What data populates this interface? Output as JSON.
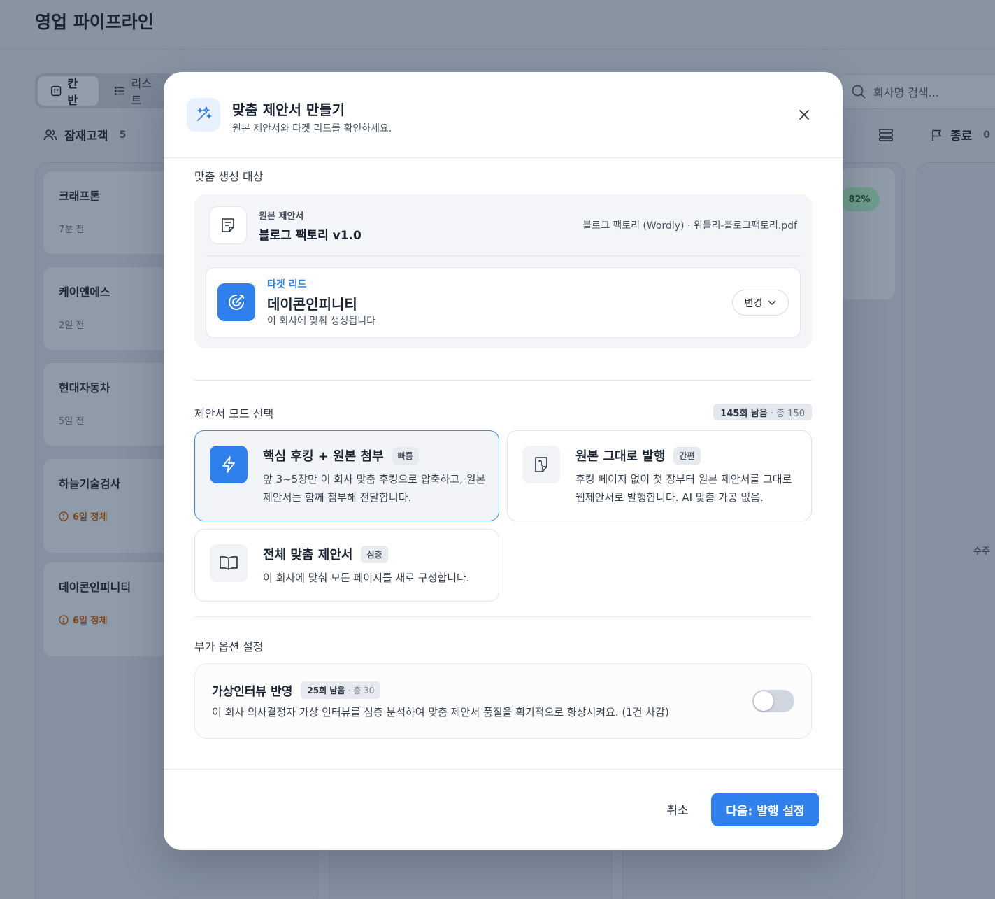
{
  "page": {
    "title": "영업 파이프라인",
    "tabs": [
      {
        "label": "칸반"
      },
      {
        "label": "리스트"
      }
    ],
    "search_placeholder": "회사명 검색...",
    "columns": [
      {
        "title": "잠재고객",
        "count": "5"
      },
      {
        "title": "종료",
        "count": "0"
      }
    ],
    "leads": [
      {
        "name": "크래프톤",
        "meta": "7분 전"
      },
      {
        "name": "케이엔에스",
        "meta": "2일 전"
      },
      {
        "name": "현대자동차",
        "meta": "5일 전"
      },
      {
        "name": "하늘기술검사",
        "meta": "6일 정체"
      },
      {
        "name": "데이콘인피니티",
        "meta": "6일 정체"
      }
    ],
    "probability_badge": "82%",
    "right_stub_text": "수주"
  },
  "modal": {
    "title": "맞춤 제안서 만들기",
    "subtitle": "원본 제안서와 타겟 리드를 확인하세요.",
    "target_section": {
      "label": "맞춤 생성 대상",
      "source_label": "원본 제안서",
      "source_name": "블로그 팩토리 v1.0",
      "source_file": "블로그 팩토리 (Wordly) · 워들리-블로그팩토리.pdf",
      "lead_kicker": "타겟 리드",
      "lead_name": "데이콘인피니티",
      "lead_desc": "이 회사에 맞춰 생성됩니다",
      "change_label": "변경"
    },
    "mode_section": {
      "label": "제안서 모드 선택",
      "quota_remaining": "145회 남음",
      "quota_total": "· 총 150",
      "modes": [
        {
          "title": "핵심 후킹 + 원본 첨부",
          "tag": "빠름",
          "desc": "앞 3~5장만 이 회사 맞춤 후킹으로 압축하고, 원본 제안서는 함께 첨부해 전달합니다.",
          "selected": true
        },
        {
          "title": "원본 그대로 발행",
          "tag": "간편",
          "desc": "후킹 페이지 없이 첫 장부터 원본 제안서를 그대로 웹제안서로 발행합니다. AI 맞춤 가공 없음.",
          "selected": false
        },
        {
          "title": "전체 맞춤 제안서",
          "tag": "심층",
          "desc": "이 회사에 맞춰 모든 페이지를 새로 구성합니다.",
          "selected": false
        }
      ]
    },
    "option_section": {
      "label": "부가 옵션 설정",
      "option_title": "가상인터뷰 반영",
      "quota_remaining": "25회 남음",
      "quota_total": "· 총 30",
      "option_desc": "이 회사 의사결정자 가상 인터뷰를 심층 분석하여 맞춤 제안서 품질을 획기적으로 향상시켜요. (1건 차감)",
      "toggle_on": false
    },
    "footer": {
      "cancel_label": "취소",
      "next_label": "다음: 발행 설정"
    }
  },
  "colors": {
    "accent": "#2f80ed",
    "overlay_bg": "#8994a3",
    "modal_bg": "#ffffff"
  }
}
